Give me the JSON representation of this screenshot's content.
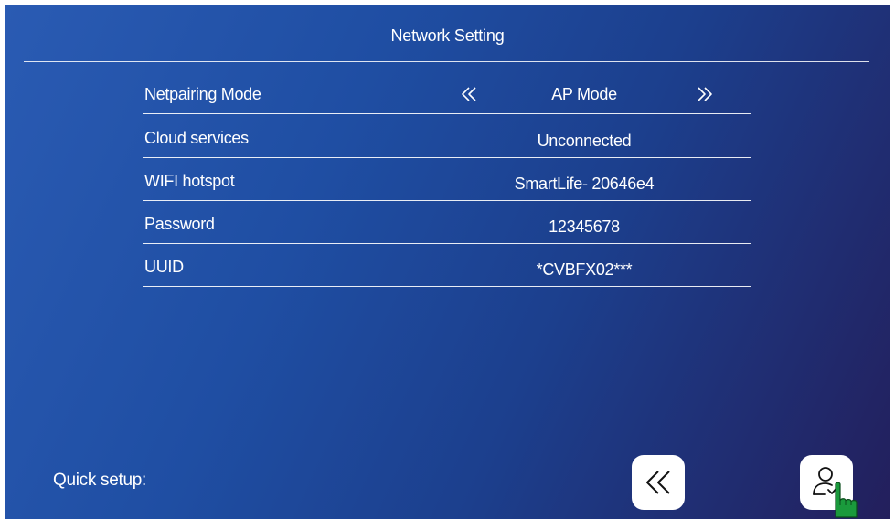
{
  "header": {
    "title": "Network Setting"
  },
  "settings": [
    {
      "label": "Netpairing Mode",
      "value": "AP Mode",
      "has_arrows": true
    },
    {
      "label": "Cloud services",
      "value": "Unconnected"
    },
    {
      "label": "WIFI hotspot",
      "value": "SmartLife- 20646e4"
    },
    {
      "label": "Password",
      "value": "12345678"
    },
    {
      "label": "UUID",
      "value": "*CVBFX02***"
    }
  ],
  "footer": {
    "quick_setup_label": "Quick setup:"
  },
  "icons": {
    "mode_prev": "double-chevron-left-icon",
    "mode_next": "double-chevron-right-icon",
    "back": "double-chevron-left-icon",
    "confirm": "user-check-icon",
    "pointer": "hand-pointer-icon"
  },
  "colors": {
    "background_start": "#2a5bb3",
    "background_end": "#231f5c",
    "text": "#ffffff",
    "button_bg": "#ffffff",
    "pointer_green": "#1a9a3c"
  }
}
